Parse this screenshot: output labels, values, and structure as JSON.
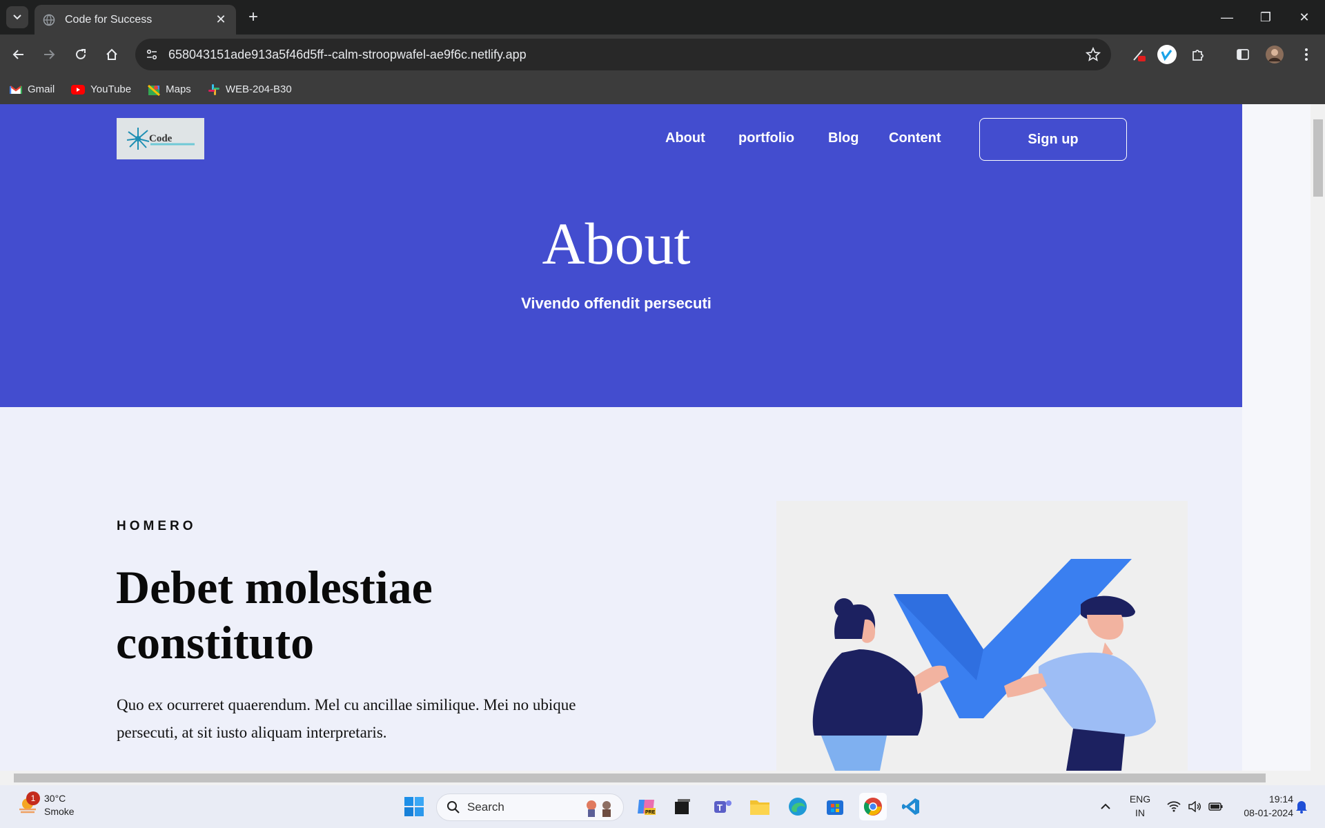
{
  "browser": {
    "tab_title": "Code for Success",
    "url": "658043151ade913a5f46d5ff--calm-stroopwafel-ae9f6c.netlify.app",
    "bookmarks": [
      {
        "label": "Gmail",
        "icon": "gmail-icon"
      },
      {
        "label": "YouTube",
        "icon": "youtube-icon"
      },
      {
        "label": "Maps",
        "icon": "maps-icon"
      },
      {
        "label": "WEB-204-B30",
        "icon": "slack-icon"
      }
    ]
  },
  "site": {
    "logo_alt": "Code for Success logo",
    "nav": [
      "About",
      "portfolio",
      "Blog",
      "Content"
    ],
    "signup_label": "Sign up",
    "hero_title": "About",
    "hero_subtitle": "Vivendo offendit persecuti",
    "eyebrow": "HOMERO",
    "headline": "Debet molestiae constituto",
    "paragraph": "Quo ex ocurreret quaerendum. Mel cu ancillae similique. Mei no ubique persecuti, at sit iusto aliquam interpretaris.",
    "colors": {
      "hero": "#434dcf",
      "page_bg": "#eef0fa",
      "check_blue": "#3a7ff0"
    }
  },
  "taskbar": {
    "weather_temp": "30°C",
    "weather_desc": "Smoke",
    "weather_badge": "1",
    "search_placeholder": "Search",
    "lang_top": "ENG",
    "lang_bottom": "IN",
    "time": "19:14",
    "date": "08-01-2024"
  }
}
